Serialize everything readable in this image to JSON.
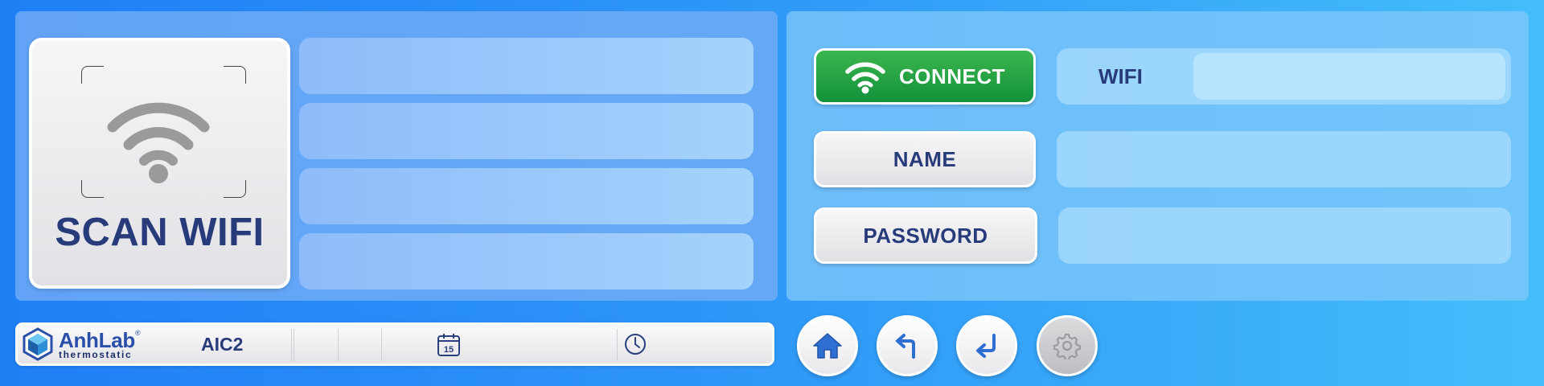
{
  "scan": {
    "label": "SCAN WIFI",
    "icon": "wifi-icon"
  },
  "wifi_list": {
    "items": [
      "",
      "",
      "",
      ""
    ]
  },
  "actions": {
    "connect_label": "CONNECT",
    "name_label": "NAME",
    "password_label": "PASSWORD"
  },
  "fields": {
    "wifi_label": "WIFI",
    "wifi_value": "",
    "name_value": "",
    "password_value": ""
  },
  "statusbar": {
    "logo_main": "AnhLab",
    "logo_reg": "®",
    "logo_sub": "thermostatic",
    "device": "AIC2",
    "date_icon": "calendar-icon",
    "calendar_day": "15",
    "time_icon": "clock-icon"
  },
  "nav": {
    "home_icon": "home-icon",
    "back_icon": "back-arrow-icon",
    "enter_icon": "enter-icon",
    "settings_icon": "gear-icon"
  },
  "colors": {
    "accent_text": "#273a7a",
    "connect_green": "#12913a",
    "background_start": "#1f7ff5",
    "background_end": "#44bdfa"
  }
}
